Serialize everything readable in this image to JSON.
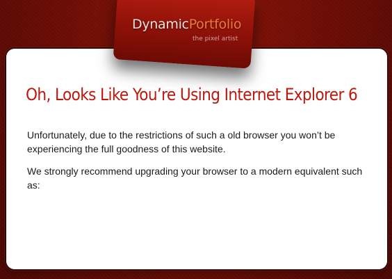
{
  "brand": {
    "name_part1": "Dynamic",
    "name_part2": "Portfolio",
    "tagline": "the pixel artist",
    "accent_color": "#f07a3a"
  },
  "notice": {
    "heading": "Oh, Looks Like You’re Using Internet Explorer 6",
    "paragraph1": "Unfortunately, due to the restrictions of such a old browser you won’t be experiencing the full goodness of this website.",
    "paragraph2": "We strongly recommend upgrading your browser to a modern equivalent such as:",
    "heading_color": "#c0170d"
  },
  "theme": {
    "background_color": "#6e0d05",
    "card_color": "#ffffff"
  }
}
